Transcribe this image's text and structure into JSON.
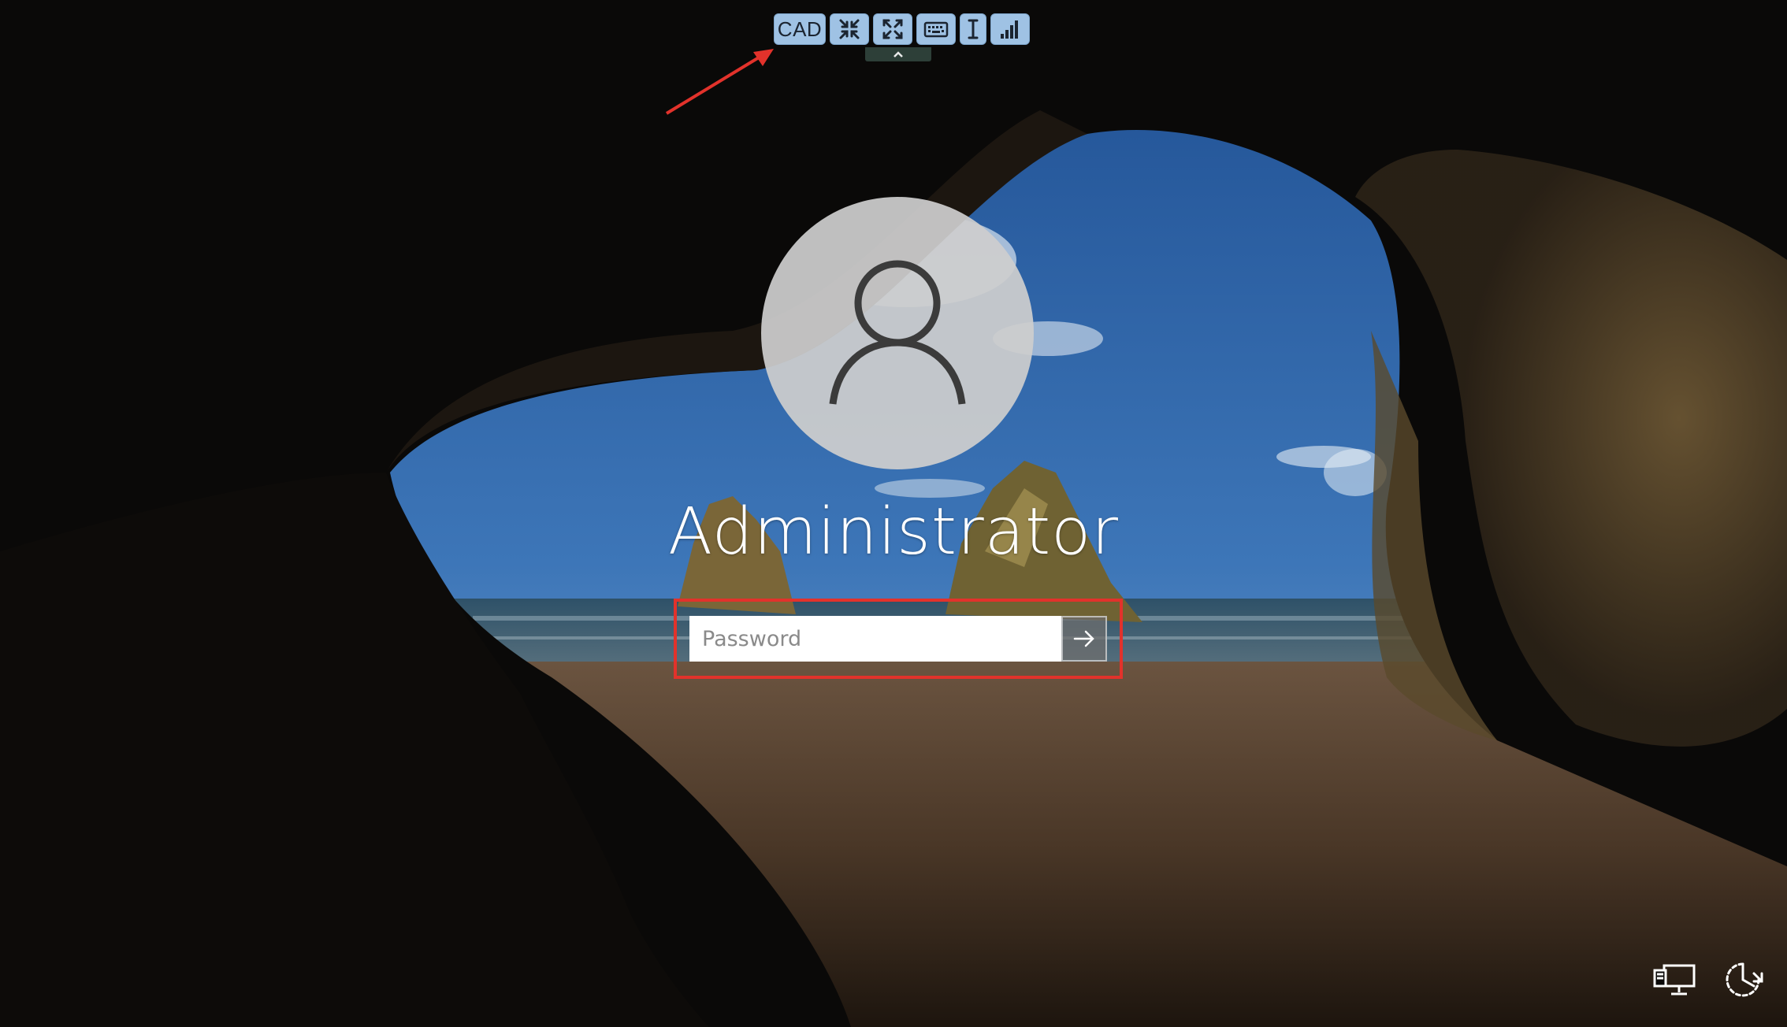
{
  "toolbar": {
    "cad_label": "CAD",
    "buttons": [
      {
        "name": "CAD",
        "icon": "cad-text"
      },
      {
        "name": "shrink",
        "icon": "compress-arrows-icon"
      },
      {
        "name": "fullscreen",
        "icon": "expand-arrows-icon"
      },
      {
        "name": "keyboard",
        "icon": "keyboard-icon"
      },
      {
        "name": "text-cursor",
        "icon": "text-cursor-icon"
      },
      {
        "name": "signal",
        "icon": "signal-bars-icon"
      }
    ],
    "handle_icon": "chevron-up-icon"
  },
  "login": {
    "avatar_icon": "user-silhouette-icon",
    "username": "Administrator",
    "password_placeholder": "Password",
    "password_value": "",
    "submit_icon": "arrow-right-icon"
  },
  "bottom_right": {
    "network_icon": "network-monitor-icon",
    "power_icon": "ease-of-access-icon"
  },
  "colors": {
    "toolbar_button": "#9fc2e4",
    "annotation_red": "#e2322b",
    "avatar_bg": "#cdcdcd"
  }
}
